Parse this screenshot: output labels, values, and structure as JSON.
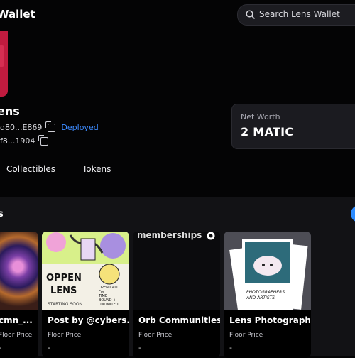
{
  "header": {
    "app_title": "Wallet",
    "search_placeholder": "Search Lens Wallet"
  },
  "profile": {
    "name": "ens",
    "address_short": "d80...E869",
    "status": "Deployed",
    "owner_short": "f8...1904"
  },
  "net_worth": {
    "label": "Net Worth",
    "value": "2 MATIC"
  },
  "tabs": [
    {
      "label": "Collectibles"
    },
    {
      "label": "Tokens"
    }
  ],
  "section": {
    "title": "s"
  },
  "cards": [
    {
      "title": "cmn_...",
      "floor_label": "Floor Price",
      "floor_value": "-"
    },
    {
      "title": "Post by @cybers...",
      "floor_label": "Floor Price",
      "floor_value": "-",
      "image_text": {
        "open": "OPPEN",
        "lens": "LENS",
        "starting": "STARTING SOON",
        "call": "OPEN CALL\nFor\nTIME\nBOUND +\nUNLIMITED"
      }
    },
    {
      "title": "Orb Communities",
      "floor_label": "Floor Price",
      "floor_value": "-",
      "image_text": {
        "memberships": "memberships"
      }
    },
    {
      "title": "Lens Photograph...",
      "floor_label": "Floor Price",
      "floor_value": "-",
      "image_text": {
        "photo": "PHOTOGRAPHERS\nAND ARTISTS"
      }
    }
  ],
  "colors": {
    "accent": "#3d8bff",
    "avatar": "#c01b3f",
    "background": "#040405"
  }
}
